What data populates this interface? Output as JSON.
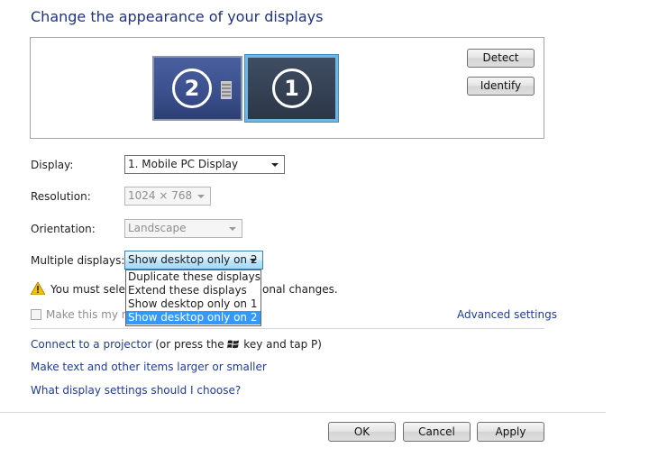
{
  "title": "Change the appearance of your displays",
  "preview": {
    "monitor_2_number": "2",
    "monitor_1_number": "1",
    "detect_label": "Detect",
    "identify_label": "Identify"
  },
  "display": {
    "label": "Display:",
    "value": "1. Mobile PC Display"
  },
  "resolution": {
    "label": "Resolution:",
    "value": "1024 × 768"
  },
  "orientation": {
    "label": "Orientation:",
    "value": "Landscape"
  },
  "multiple_displays": {
    "label": "Multiple displays:",
    "value": "Show desktop only on 2",
    "options": [
      "Duplicate these displays",
      "Extend these displays",
      "Show desktop only on 1",
      "Show desktop only on 2"
    ]
  },
  "warning": {
    "text_left": "You must selec",
    "text_right": "onal changes."
  },
  "main_display_checkbox": {
    "label": "Make this my ma"
  },
  "advanced_settings": "Advanced settings",
  "links": {
    "projector_link": "Connect to a projector",
    "projector_rest": " (or press the ",
    "projector_end": " key and tap P)",
    "text_size": "Make text and other items larger or smaller",
    "which_settings": "What display settings should I choose?"
  },
  "buttons": {
    "ok": "OK",
    "cancel": "Cancel",
    "apply": "Apply"
  },
  "colors": {
    "title": "#1e3287",
    "link": "#1e3c96",
    "selection": "#3399ff"
  }
}
